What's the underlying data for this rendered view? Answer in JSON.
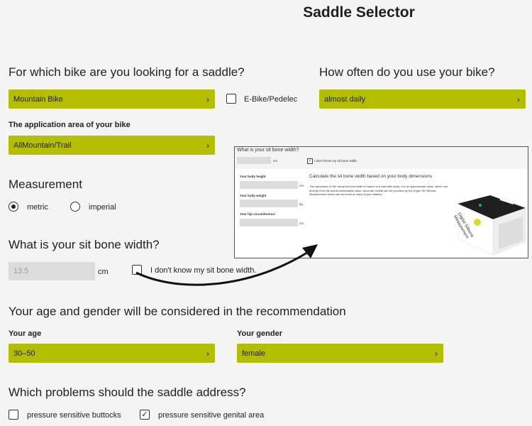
{
  "title": "Saddle Selector",
  "bike": {
    "question": "For which bike are you looking for a saddle?",
    "selected": "Mountain Bike",
    "ebike_label": "E-Bike/Pedelec",
    "application_label": "The application area of your bike",
    "application_selected": "AllMountain/Trail"
  },
  "usage": {
    "question": "How often do you use your bike?",
    "selected": "almost daily"
  },
  "measurement": {
    "heading": "Measurement",
    "options": [
      "metric",
      "imperial"
    ],
    "selected": "metric"
  },
  "sitbone": {
    "question": "What is your sit bone width?",
    "value": "13.5",
    "unit": "cm",
    "unknown_label": "I don't know my sit bone width."
  },
  "age_gender": {
    "heading": "Your age and gender will be considered in the recommendation",
    "age_label": "Your age",
    "age_selected": "30–50",
    "gender_label": "Your gender",
    "gender_selected": "female"
  },
  "problems": {
    "question": "Which problems should the saddle address?",
    "options": [
      {
        "label": "pressure sensitive buttocks",
        "checked": false
      },
      {
        "label": "pressure sensitive genital area",
        "checked": true
      }
    ]
  },
  "inset": {
    "question": "What is your sit bone width?",
    "unit": "cm",
    "unknown_label": "I don't know my sit bone width.",
    "height_label": "Your body height",
    "height_unit": "cm",
    "weight_label": "Your body weight",
    "weight_unit": "kg",
    "hip_label": "Your hip circumference",
    "hip_unit": "cm",
    "calc_title": "Calculate the sit bone width based on your body dimensions",
    "calc_text": "The calculation of the virtual sit bone width is based on a scientific study. It is an approximate value, which can diverge from the actual measurable value. Accurate results can be provided by the Ergon 3D Sitbone-Measurement which can be found at many Ergon retailers.",
    "box_text": "Digital Sitbone Measurement"
  },
  "colors": {
    "accent": "#b4be00",
    "background": "#f4f4f4"
  },
  "icons": [
    "chevron-right-icon",
    "check-icon",
    "arrow-icon"
  ]
}
